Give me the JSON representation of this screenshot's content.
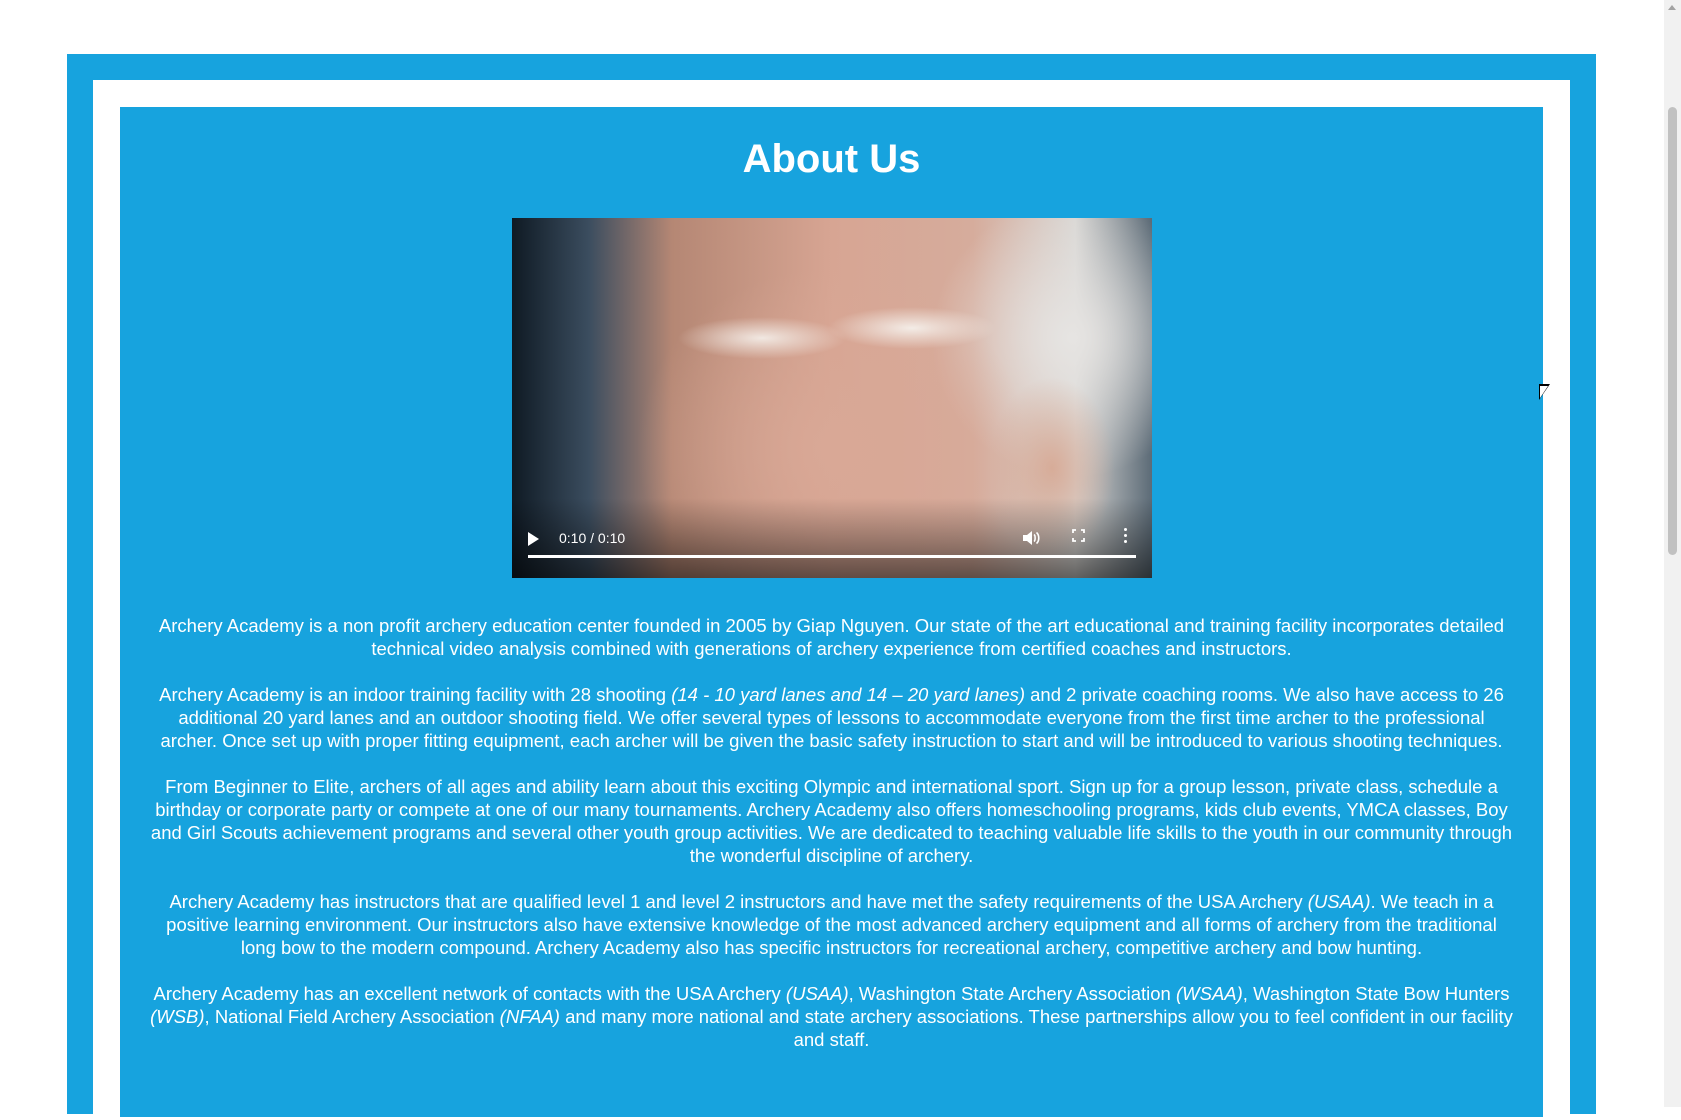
{
  "page": {
    "title": "About Us"
  },
  "video": {
    "time_display": "0:10 / 0:10",
    "progress": 1.0
  },
  "paragraphs": [
    {
      "segments": [
        {
          "text": "Archery Academy is a non profit archery education center founded in 2005 by Giap Nguyen. Our state of the art educational and training facility incorporates detailed technical video analysis combined with generations of archery experience from certified coaches and instructors.",
          "italic": false
        }
      ]
    },
    {
      "segments": [
        {
          "text": "Archery Academy is an indoor training facility with 28 shooting ",
          "italic": false
        },
        {
          "text": "(14 - 10 yard lanes and 14 – 20 yard lanes)",
          "italic": true
        },
        {
          "text": " and 2 private coaching rooms. We also have access to 26 additional 20 yard lanes and an outdoor shooting field. We offer several types of lessons to accommodate everyone from the first time archer to the professional archer. Once set up with proper fitting equipment, each archer will be given the basic safety instruction to start and will be introduced to various shooting techniques.",
          "italic": false
        }
      ]
    },
    {
      "segments": [
        {
          "text": "From Beginner to Elite, archers of all ages and ability learn about this exciting Olympic and international sport. Sign up for a group lesson, private class, schedule a birthday or corporate party or compete at one of our many tournaments. Archery Academy also offers homeschooling programs, kids club events, YMCA classes, Boy and Girl Scouts achievement programs and several other youth group activities. We are dedicated to teaching valuable life skills to the youth in our community through the wonderful discipline of archery.",
          "italic": false
        }
      ]
    },
    {
      "segments": [
        {
          "text": "Archery Academy has instructors that are qualified level 1 and level 2 instructors and have met the safety requirements of the USA Archery ",
          "italic": false
        },
        {
          "text": "(USAA)",
          "italic": true
        },
        {
          "text": ". We teach in a positive learning environment. Our instructors also have extensive knowledge of the most advanced archery equipment and all forms of archery from the traditional long bow to the modern compound. Archery Academy also has specific instructors for recreational archery, competitive archery and bow hunting.",
          "italic": false
        }
      ]
    },
    {
      "segments": [
        {
          "text": "Archery Academy has an excellent network of contacts with the USA Archery ",
          "italic": false
        },
        {
          "text": "(USAA)",
          "italic": true
        },
        {
          "text": ", Washington State Archery Association ",
          "italic": false
        },
        {
          "text": "(WSAA)",
          "italic": true
        },
        {
          "text": ", Washington State Bow Hunters ",
          "italic": false
        },
        {
          "text": "(WSB)",
          "italic": true
        },
        {
          "text": ", National Field Archery Association ",
          "italic": false
        },
        {
          "text": "(NFAA)",
          "italic": true
        },
        {
          "text": " and many more national and state archery associations. These partnerships allow you to feel confident in our facility and staff.",
          "italic": false
        }
      ]
    }
  ],
  "colors": {
    "brand_blue": "#17a3de",
    "text": "#ffffff"
  },
  "icons": {
    "play": "play-icon",
    "volume": "volume-icon",
    "fullscreen": "fullscreen-icon",
    "more": "more-options-icon"
  }
}
